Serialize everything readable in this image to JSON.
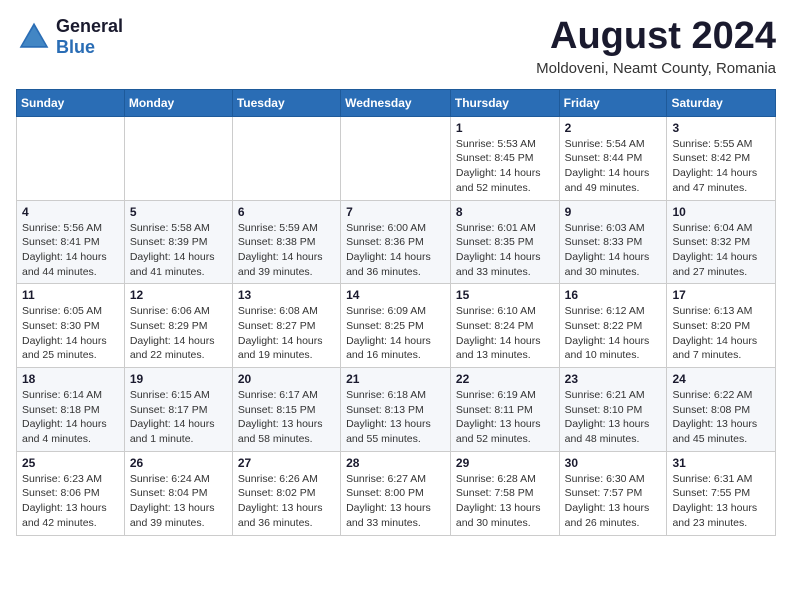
{
  "header": {
    "logo": {
      "general": "General",
      "blue": "Blue"
    },
    "month_year": "August 2024",
    "location": "Moldoveni, Neamt County, Romania"
  },
  "calendar": {
    "days_of_week": [
      "Sunday",
      "Monday",
      "Tuesday",
      "Wednesday",
      "Thursday",
      "Friday",
      "Saturday"
    ],
    "weeks": [
      [
        {
          "day": "",
          "info": ""
        },
        {
          "day": "",
          "info": ""
        },
        {
          "day": "",
          "info": ""
        },
        {
          "day": "",
          "info": ""
        },
        {
          "day": "1",
          "info": "Sunrise: 5:53 AM\nSunset: 8:45 PM\nDaylight: 14 hours\nand 52 minutes."
        },
        {
          "day": "2",
          "info": "Sunrise: 5:54 AM\nSunset: 8:44 PM\nDaylight: 14 hours\nand 49 minutes."
        },
        {
          "day": "3",
          "info": "Sunrise: 5:55 AM\nSunset: 8:42 PM\nDaylight: 14 hours\nand 47 minutes."
        }
      ],
      [
        {
          "day": "4",
          "info": "Sunrise: 5:56 AM\nSunset: 8:41 PM\nDaylight: 14 hours\nand 44 minutes."
        },
        {
          "day": "5",
          "info": "Sunrise: 5:58 AM\nSunset: 8:39 PM\nDaylight: 14 hours\nand 41 minutes."
        },
        {
          "day": "6",
          "info": "Sunrise: 5:59 AM\nSunset: 8:38 PM\nDaylight: 14 hours\nand 39 minutes."
        },
        {
          "day": "7",
          "info": "Sunrise: 6:00 AM\nSunset: 8:36 PM\nDaylight: 14 hours\nand 36 minutes."
        },
        {
          "day": "8",
          "info": "Sunrise: 6:01 AM\nSunset: 8:35 PM\nDaylight: 14 hours\nand 33 minutes."
        },
        {
          "day": "9",
          "info": "Sunrise: 6:03 AM\nSunset: 8:33 PM\nDaylight: 14 hours\nand 30 minutes."
        },
        {
          "day": "10",
          "info": "Sunrise: 6:04 AM\nSunset: 8:32 PM\nDaylight: 14 hours\nand 27 minutes."
        }
      ],
      [
        {
          "day": "11",
          "info": "Sunrise: 6:05 AM\nSunset: 8:30 PM\nDaylight: 14 hours\nand 25 minutes."
        },
        {
          "day": "12",
          "info": "Sunrise: 6:06 AM\nSunset: 8:29 PM\nDaylight: 14 hours\nand 22 minutes."
        },
        {
          "day": "13",
          "info": "Sunrise: 6:08 AM\nSunset: 8:27 PM\nDaylight: 14 hours\nand 19 minutes."
        },
        {
          "day": "14",
          "info": "Sunrise: 6:09 AM\nSunset: 8:25 PM\nDaylight: 14 hours\nand 16 minutes."
        },
        {
          "day": "15",
          "info": "Sunrise: 6:10 AM\nSunset: 8:24 PM\nDaylight: 14 hours\nand 13 minutes."
        },
        {
          "day": "16",
          "info": "Sunrise: 6:12 AM\nSunset: 8:22 PM\nDaylight: 14 hours\nand 10 minutes."
        },
        {
          "day": "17",
          "info": "Sunrise: 6:13 AM\nSunset: 8:20 PM\nDaylight: 14 hours\nand 7 minutes."
        }
      ],
      [
        {
          "day": "18",
          "info": "Sunrise: 6:14 AM\nSunset: 8:18 PM\nDaylight: 14 hours\nand 4 minutes."
        },
        {
          "day": "19",
          "info": "Sunrise: 6:15 AM\nSunset: 8:17 PM\nDaylight: 14 hours\nand 1 minute."
        },
        {
          "day": "20",
          "info": "Sunrise: 6:17 AM\nSunset: 8:15 PM\nDaylight: 13 hours\nand 58 minutes."
        },
        {
          "day": "21",
          "info": "Sunrise: 6:18 AM\nSunset: 8:13 PM\nDaylight: 13 hours\nand 55 minutes."
        },
        {
          "day": "22",
          "info": "Sunrise: 6:19 AM\nSunset: 8:11 PM\nDaylight: 13 hours\nand 52 minutes."
        },
        {
          "day": "23",
          "info": "Sunrise: 6:21 AM\nSunset: 8:10 PM\nDaylight: 13 hours\nand 48 minutes."
        },
        {
          "day": "24",
          "info": "Sunrise: 6:22 AM\nSunset: 8:08 PM\nDaylight: 13 hours\nand 45 minutes."
        }
      ],
      [
        {
          "day": "25",
          "info": "Sunrise: 6:23 AM\nSunset: 8:06 PM\nDaylight: 13 hours\nand 42 minutes."
        },
        {
          "day": "26",
          "info": "Sunrise: 6:24 AM\nSunset: 8:04 PM\nDaylight: 13 hours\nand 39 minutes."
        },
        {
          "day": "27",
          "info": "Sunrise: 6:26 AM\nSunset: 8:02 PM\nDaylight: 13 hours\nand 36 minutes."
        },
        {
          "day": "28",
          "info": "Sunrise: 6:27 AM\nSunset: 8:00 PM\nDaylight: 13 hours\nand 33 minutes."
        },
        {
          "day": "29",
          "info": "Sunrise: 6:28 AM\nSunset: 7:58 PM\nDaylight: 13 hours\nand 30 minutes."
        },
        {
          "day": "30",
          "info": "Sunrise: 6:30 AM\nSunset: 7:57 PM\nDaylight: 13 hours\nand 26 minutes."
        },
        {
          "day": "31",
          "info": "Sunrise: 6:31 AM\nSunset: 7:55 PM\nDaylight: 13 hours\nand 23 minutes."
        }
      ]
    ]
  }
}
